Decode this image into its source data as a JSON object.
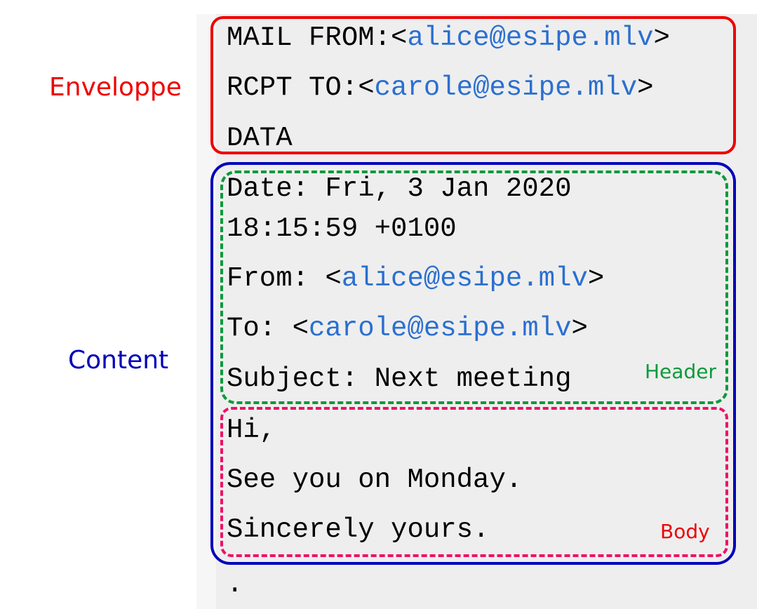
{
  "labels": {
    "envelope": "Enveloppe",
    "content": "Content",
    "header": "Header",
    "body": "Body"
  },
  "envelope": {
    "mail_from_prefix": "MAIL FROM:<",
    "mail_from_address": "alice@esipe.mlv",
    "mail_from_suffix": ">",
    "rcpt_to_prefix": "RCPT TO:<",
    "rcpt_to_address": "carole@esipe.mlv",
    "rcpt_to_suffix": ">",
    "data": "DATA"
  },
  "header": {
    "date_line1": "Date: Fri, 3 Jan 2020",
    "date_line2": "18:15:59 +0100",
    "from_prefix": "From: <",
    "from_address": "alice@esipe.mlv",
    "from_suffix": ">",
    "to_prefix": "To: <",
    "to_address": "carole@esipe.mlv",
    "to_suffix": ">",
    "subject": "Subject: Next meeting"
  },
  "body": {
    "line1": "Hi,",
    "line2": "See you on Monday.",
    "line3": "Sincerely yours."
  },
  "terminator": ".",
  "colors": {
    "envelope": "#ee0000",
    "content": "#0000bb",
    "header": "#0a9a3a",
    "body": "#ee1166",
    "address": "#2a6fd0"
  }
}
